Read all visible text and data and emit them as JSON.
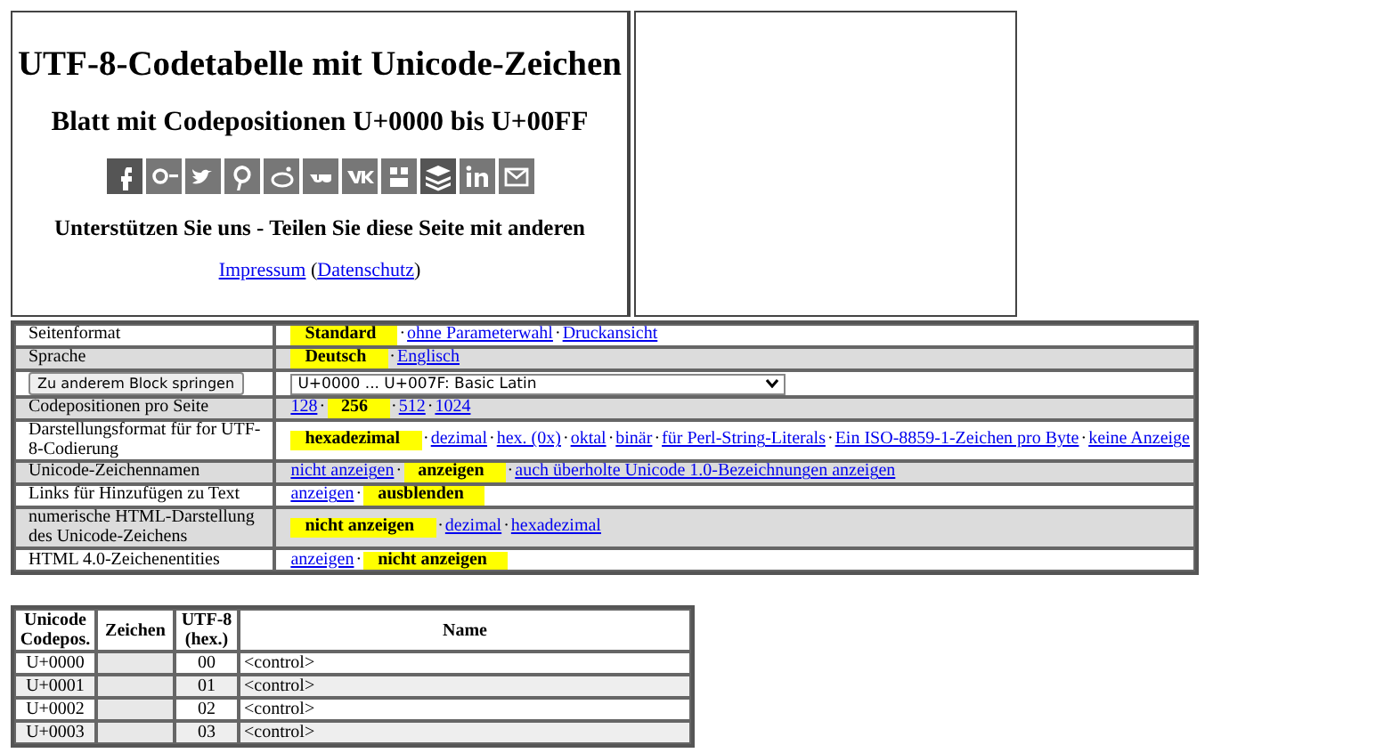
{
  "header": {
    "title": "UTF-8-Codetabelle mit Unicode-Zeichen",
    "subtitle": "Blatt mit Codepositionen U+0000 bis U+00FF",
    "support_text": "Unterstützen Sie uns - Teilen Sie diese Seite mit anderen",
    "links": [
      {
        "label": "Impressum"
      },
      {
        "label": "Datenschutz",
        "before": "(",
        "after": ")"
      }
    ]
  },
  "options": [
    {
      "label": "Seitenformat",
      "kind": "choices",
      "options": [
        {
          "label": "Standard",
          "selected": true,
          "sep": "·"
        },
        {
          "label": "ohne Parameterwahl",
          "selected": false,
          "sep": "·"
        },
        {
          "label": "Druckansicht",
          "selected": false
        }
      ]
    },
    {
      "label": "Sprache",
      "kind": "choices",
      "options": [
        {
          "label": "Deutsch",
          "selected": true,
          "sep": "·"
        },
        {
          "label": "Englisch",
          "selected": false
        }
      ]
    },
    {
      "kind": "jump",
      "button": "Zu anderem Block springen",
      "select_value": "U+0000 ... U+007F: Basic Latin"
    },
    {
      "label": "Codepositionen pro Seite",
      "kind": "choices",
      "options": [
        {
          "label": "128",
          "selected": false,
          "sep": "·"
        },
        {
          "label": "256",
          "selected": true,
          "sep": "·"
        },
        {
          "label": "512",
          "selected": false,
          "sep": "·"
        },
        {
          "label": "1024",
          "selected": false
        }
      ]
    },
    {
      "label": "Darstellungsformat für for UTF-8-Codierung",
      "kind": "choices",
      "options": [
        {
          "label": "hexadezimal",
          "selected": true,
          "sep": "·"
        },
        {
          "label": "dezimal",
          "selected": false,
          "sep": "·"
        },
        {
          "label": "hex. (0x)",
          "selected": false,
          "sep": "·"
        },
        {
          "label": "oktal",
          "selected": false,
          "sep": "·"
        },
        {
          "label": "binär",
          "selected": false,
          "sep": "·"
        },
        {
          "label": "für Perl-String-Literals",
          "selected": false,
          "sep": "·"
        },
        {
          "label": "Ein ISO-8859-1-Zeichen pro Byte",
          "selected": false,
          "sep": "·"
        },
        {
          "label": "keine Anzeige",
          "selected": false
        }
      ]
    },
    {
      "label": "Unicode-Zeichennamen",
      "kind": "choices",
      "options": [
        {
          "label": "nicht anzeigen",
          "selected": false,
          "sep": "·"
        },
        {
          "label": "anzeigen",
          "selected": true,
          "sep": "·"
        },
        {
          "label": "auch überholte Unicode 1.0-Bezeichnungen anzeigen",
          "selected": false
        }
      ]
    },
    {
      "label": "Links für Hinzufügen zu Text",
      "kind": "choices",
      "options": [
        {
          "label": "anzeigen",
          "selected": false,
          "sep": "·"
        },
        {
          "label": "ausblenden",
          "selected": true
        }
      ]
    },
    {
      "label": "numerische HTML-Darstellung des Unicode-Zeichens",
      "kind": "choices",
      "options": [
        {
          "label": "nicht anzeigen",
          "selected": true,
          "sep": "·"
        },
        {
          "label": "dezimal",
          "selected": false,
          "sep": "·"
        },
        {
          "label": "hexadezimal",
          "selected": false
        }
      ]
    },
    {
      "label": "HTML 4.0-Zeichenentities",
      "kind": "choices",
      "options": [
        {
          "label": "anzeigen",
          "selected": false,
          "sep": "·"
        },
        {
          "label": "nicht anzeigen",
          "selected": true
        }
      ]
    }
  ],
  "code_table": {
    "columns": [
      "Unicode Codepos.",
      "Zeichen",
      "UTF-8 (hex.)",
      "Name"
    ],
    "rows": [
      {
        "codepos": "U+0000",
        "utf8": "00",
        "name": "<control>"
      },
      {
        "codepos": "U+0001",
        "utf8": "01",
        "name": "<control>"
      },
      {
        "codepos": "U+0002",
        "utf8": "02",
        "name": "<control>"
      },
      {
        "codepos": "U+0003",
        "utf8": "03",
        "name": "<control>"
      }
    ]
  }
}
